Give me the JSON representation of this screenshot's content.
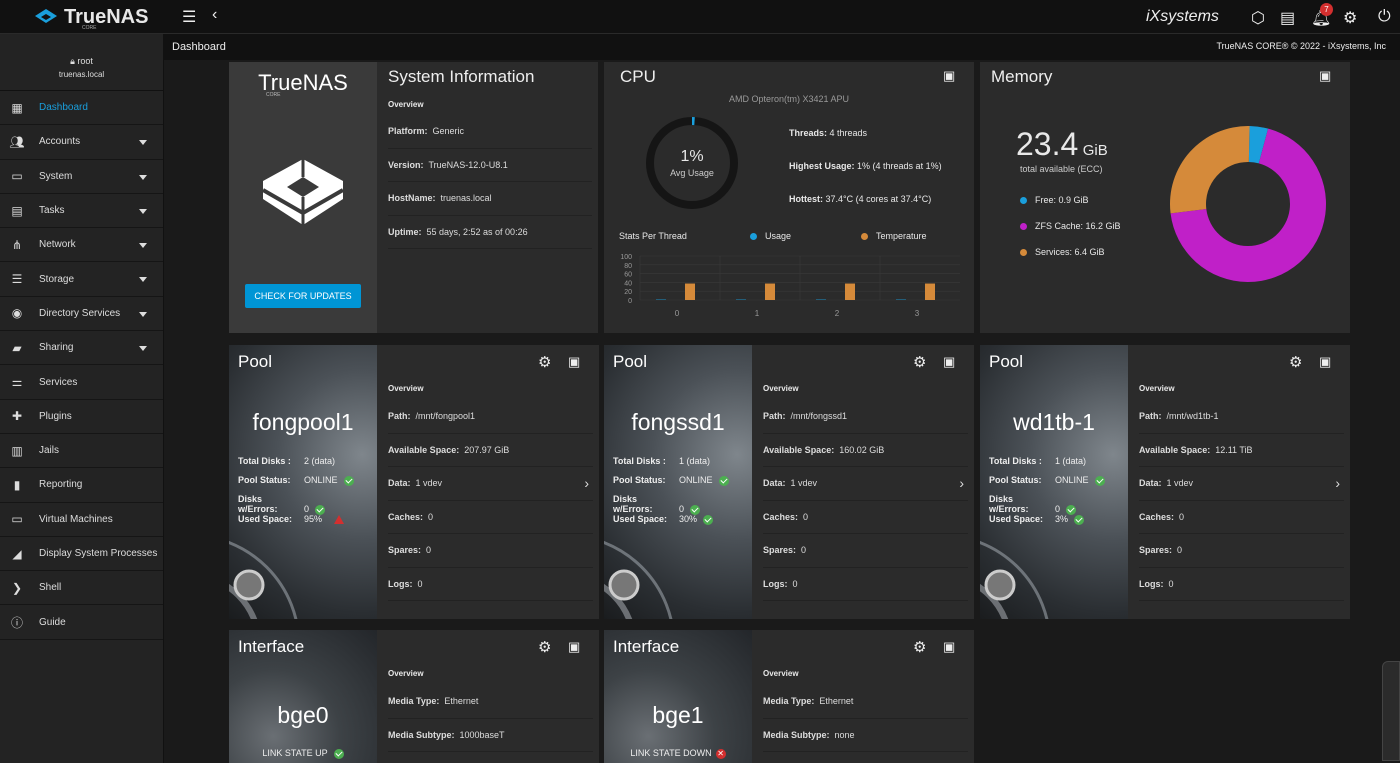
{
  "topbar": {
    "logo_text": "TrueNAS",
    "logo_sub": "CORE",
    "brand": "iXsystems",
    "notification_count": "7"
  },
  "breadcrumb": {
    "title": "Dashboard",
    "copyright": "TrueNAS CORE® © 2022 - iXsystems, Inc"
  },
  "user": {
    "name": "root",
    "host": "truenas.local"
  },
  "sidebar": {
    "items": [
      {
        "label": "Dashboard",
        "icon": "dashboard-icon"
      },
      {
        "label": "Accounts",
        "icon": "accounts-icon"
      },
      {
        "label": "System",
        "icon": "system-icon"
      },
      {
        "label": "Tasks",
        "icon": "tasks-icon"
      },
      {
        "label": "Network",
        "icon": "network-icon"
      },
      {
        "label": "Storage",
        "icon": "storage-icon"
      },
      {
        "label": "Directory Services",
        "icon": "directory-icon"
      },
      {
        "label": "Sharing",
        "icon": "sharing-icon"
      },
      {
        "label": "Services",
        "icon": "services-icon"
      },
      {
        "label": "Plugins",
        "icon": "plugins-icon"
      },
      {
        "label": "Jails",
        "icon": "jails-icon"
      },
      {
        "label": "Reporting",
        "icon": "reporting-icon"
      },
      {
        "label": "Virtual Machines",
        "icon": "vm-icon"
      },
      {
        "label": "Display System Processes",
        "icon": "processes-icon"
      },
      {
        "label": "Shell",
        "icon": "shell-icon"
      },
      {
        "label": "Guide",
        "icon": "guide-icon"
      }
    ]
  },
  "sysinfo": {
    "logo": "TrueNAS",
    "logo_sub": "CORE",
    "update_button": "CHECK FOR UPDATES",
    "title": "System Information",
    "overview": "Overview",
    "rows": [
      {
        "label": "Platform:",
        "value": "Generic"
      },
      {
        "label": "Version:",
        "value": "TrueNAS-12.0-U8.1"
      },
      {
        "label": "HostName:",
        "value": "truenas.local"
      },
      {
        "label": "Uptime:",
        "value": "55 days, 2:52 as of 00:26"
      }
    ]
  },
  "cpu": {
    "title": "CPU",
    "model": "AMD Opteron(tm) X3421 APU",
    "avg_value": "1%",
    "avg_label": "Avg Usage",
    "avg_fraction": 0.01,
    "stats": [
      {
        "label": "Threads:",
        "value": "4 threads"
      },
      {
        "label": "Highest Usage:",
        "value": "1%  (4 threads at 1%)"
      },
      {
        "label": "Hottest:",
        "value": "37.4°C  (4 cores at 37.4°C)"
      }
    ],
    "per_thread_label": "Stats Per Thread",
    "legend_usage": "Usage",
    "legend_temp": "Temperature",
    "usage_color": "#1a9fdc",
    "temp_color": "#d58a3a"
  },
  "chart_data": {
    "type": "bar",
    "categories": [
      "0",
      "1",
      "2",
      "3"
    ],
    "series": [
      {
        "name": "Usage",
        "values": [
          1,
          1,
          1,
          1
        ]
      },
      {
        "name": "Temperature",
        "values": [
          37.4,
          37.4,
          37.4,
          37.4
        ]
      }
    ],
    "ylim": [
      0,
      100
    ],
    "yticks": [
      "100",
      "80",
      "60",
      "40",
      "20",
      "0"
    ]
  },
  "memory": {
    "title": "Memory",
    "total": "23.4",
    "unit": "GiB",
    "total_label": "total available (ECC)",
    "legend": [
      {
        "label": "Free: 0.9 GiB",
        "value": 0.9,
        "color": "#1a9fdc"
      },
      {
        "label": "ZFS Cache: 16.2 GiB",
        "value": 16.2,
        "color": "#c020c8"
      },
      {
        "label": "Services: 6.4 GiB",
        "value": 6.4,
        "color": "#d58a3a"
      }
    ]
  },
  "pools": [
    {
      "title": "Pool",
      "name": "fongpool1",
      "total_disks": "2 (data)",
      "status": "ONLINE",
      "errors": "0",
      "used": "95%",
      "used_ok": false,
      "path": "/mnt/fongpool1",
      "avail": "207.97 GiB",
      "data": "1 vdev",
      "caches": "0",
      "spares": "0",
      "logs": "0"
    },
    {
      "title": "Pool",
      "name": "fongssd1",
      "total_disks": "1 (data)",
      "status": "ONLINE",
      "errors": "0",
      "used": "30%",
      "used_ok": true,
      "path": "/mnt/fongssd1",
      "avail": "160.02 GiB",
      "data": "1 vdev",
      "caches": "0",
      "spares": "0",
      "logs": "0"
    },
    {
      "title": "Pool",
      "name": "wd1tb-1",
      "total_disks": "1 (data)",
      "status": "ONLINE",
      "errors": "0",
      "used": "3%",
      "used_ok": true,
      "path": "/mnt/wd1tb-1",
      "avail": "12.11 TiB",
      "data": "1 vdev",
      "caches": "0",
      "spares": "0",
      "logs": "0"
    }
  ],
  "pool_labels": {
    "overview": "Overview",
    "total_disks": "Total Disks :",
    "pool_status": "Pool Status:",
    "disks_errors": "Disks w/Errors:",
    "used_space": "Used Space:",
    "path": "Path:",
    "avail": "Available Space:",
    "data": "Data:",
    "caches": "Caches:",
    "spares": "Spares:",
    "logs": "Logs:"
  },
  "interfaces": [
    {
      "title": "Interface",
      "name": "bge0",
      "link": "LINK STATE UP",
      "up": true,
      "media_type": "Ethernet",
      "media_subtype": "1000baseT"
    },
    {
      "title": "Interface",
      "name": "bge1",
      "link": "LINK STATE DOWN",
      "up": false,
      "media_type": "Ethernet",
      "media_subtype": "none"
    }
  ],
  "iface_labels": {
    "overview": "Overview",
    "media_type": "Media Type:",
    "media_subtype": "Media Subtype:"
  }
}
